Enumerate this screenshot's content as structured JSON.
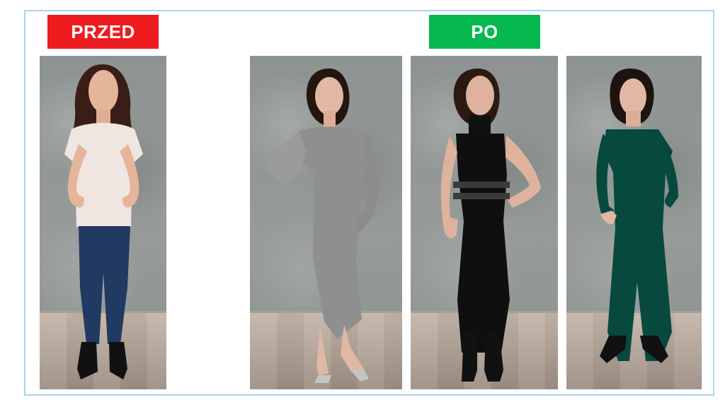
{
  "labels": {
    "before": "PRZED",
    "after": "PO"
  },
  "colors": {
    "before": "#ef1c1f",
    "after": "#05b84f",
    "frame": "#a9d6ea"
  }
}
